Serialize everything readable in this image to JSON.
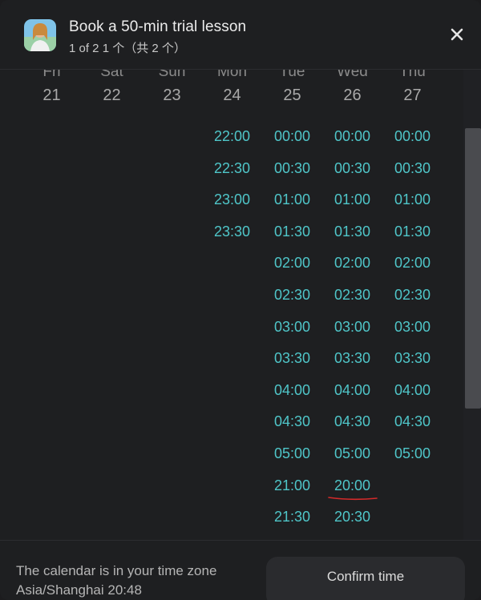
{
  "header": {
    "title": "Book a 50-min trial lesson",
    "subtitle": "1 of 2 1 个（共 2 个）"
  },
  "icons": {
    "avatar": "tutor-avatar",
    "close": "close-icon"
  },
  "calendar": {
    "days": [
      {
        "name": "Fri",
        "date": "21",
        "slots": []
      },
      {
        "name": "Sat",
        "date": "22",
        "slots": []
      },
      {
        "name": "Sun",
        "date": "23",
        "slots": []
      },
      {
        "name": "Mon",
        "date": "24",
        "slots": [
          "22:00",
          "22:30",
          "23:00",
          "23:30"
        ]
      },
      {
        "name": "Tue",
        "date": "25",
        "slots": [
          "00:00",
          "00:30",
          "01:00",
          "01:30",
          "02:00",
          "02:30",
          "03:00",
          "03:30",
          "04:00",
          "04:30",
          "05:00",
          "21:00",
          "21:30"
        ]
      },
      {
        "name": "Wed",
        "date": "26",
        "slots": [
          "00:00",
          "00:30",
          "01:00",
          "01:30",
          "02:00",
          "02:30",
          "03:00",
          "03:30",
          "04:00",
          "04:30",
          "05:00",
          "20:00",
          "20:30"
        ]
      },
      {
        "name": "Thu",
        "date": "27",
        "slots": [
          "00:00",
          "00:30",
          "01:00",
          "01:30",
          "02:00",
          "02:30",
          "03:00",
          "03:30",
          "04:00",
          "04:30",
          "05:00"
        ]
      }
    ],
    "annotated_slot": {
      "day": "Wed",
      "time": "20:00"
    }
  },
  "footer": {
    "timezone_line1": "The calendar is in your time zone",
    "timezone_line2": "Asia/Shanghai 20:48",
    "confirm_label": "Confirm time"
  },
  "colors": {
    "slot": "#4fc6c9",
    "background": "#1e1f21",
    "annotation": "#d42a2a"
  }
}
